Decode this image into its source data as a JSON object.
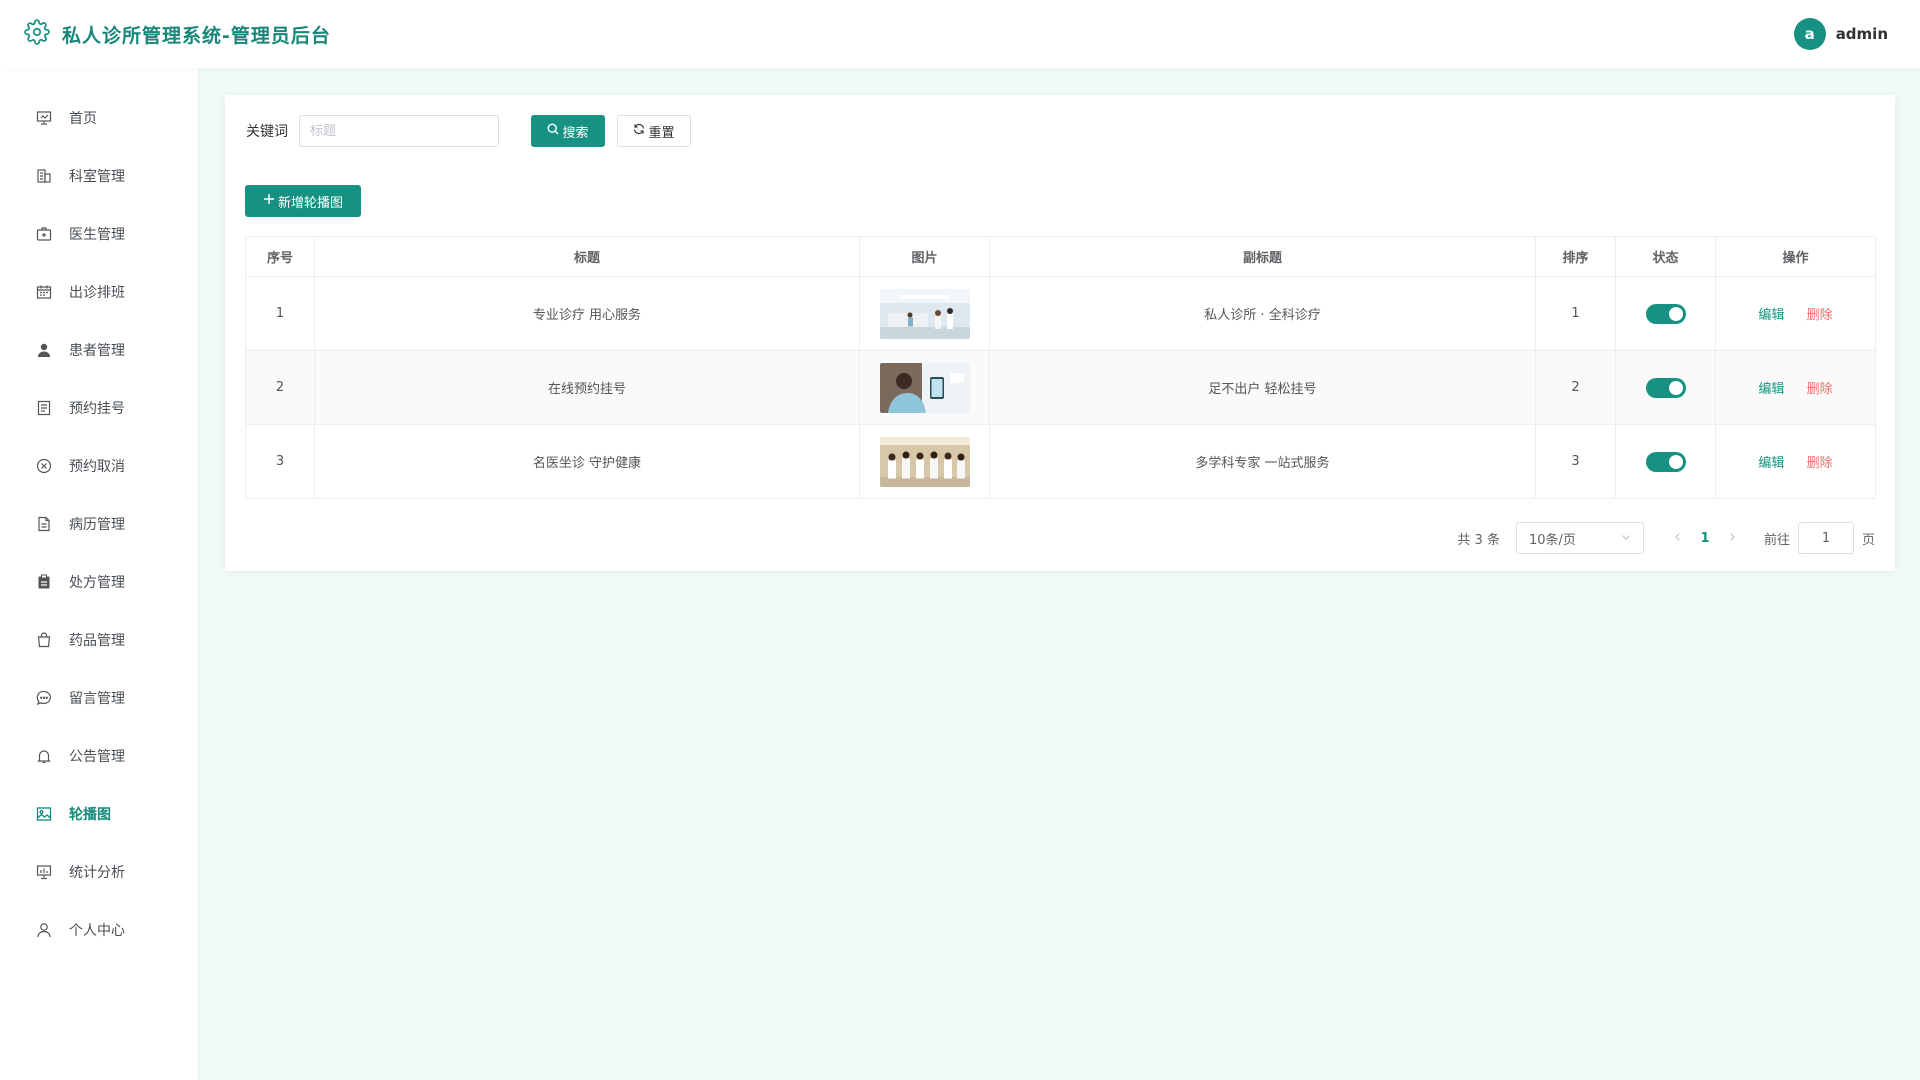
{
  "header": {
    "title": "私人诊所管理系统-管理员后台",
    "logo_icon": "gear-icon",
    "avatar_letter": "a",
    "username": "admin"
  },
  "sidebar": {
    "items": [
      {
        "label": "首页",
        "icon": "presentation-icon"
      },
      {
        "label": "科室管理",
        "icon": "building-icon"
      },
      {
        "label": "医生管理",
        "icon": "medical-kit-icon"
      },
      {
        "label": "出诊排班",
        "icon": "calendar-icon"
      },
      {
        "label": "患者管理",
        "icon": "user-filled-icon"
      },
      {
        "label": "预约挂号",
        "icon": "document-icon"
      },
      {
        "label": "预约取消",
        "icon": "circle-close-icon"
      },
      {
        "label": "病历管理",
        "icon": "file-icon"
      },
      {
        "label": "处方管理",
        "icon": "clipboard-icon"
      },
      {
        "label": "药品管理",
        "icon": "shopping-bag-icon"
      },
      {
        "label": "留言管理",
        "icon": "chat-icon"
      },
      {
        "label": "公告管理",
        "icon": "bell-icon"
      },
      {
        "label": "轮播图",
        "icon": "picture-icon",
        "active": true
      },
      {
        "label": "统计分析",
        "icon": "data-board-icon"
      },
      {
        "label": "个人中心",
        "icon": "user-icon"
      }
    ]
  },
  "search": {
    "label": "关键词",
    "placeholder": "标题",
    "value": "",
    "search_button": "搜索",
    "reset_button": "重置"
  },
  "add_button": "新增轮播图",
  "table": {
    "columns": [
      "序号",
      "标题",
      "图片",
      "副标题",
      "排序",
      "状态",
      "操作"
    ],
    "rows": [
      {
        "index": "1",
        "title": "专业诊疗 用心服务",
        "image": "clinic-lobby",
        "subtitle": "私人诊所 · 全科诊疗",
        "sort": "1",
        "enabled": true
      },
      {
        "index": "2",
        "title": "在线预约挂号",
        "image": "online-booking",
        "subtitle": "足不出户 轻松挂号",
        "sort": "2",
        "enabled": true
      },
      {
        "index": "3",
        "title": "名医坐诊 守护健康",
        "image": "doctor-team",
        "subtitle": "多学科专家 一站式服务",
        "sort": "3",
        "enabled": true
      }
    ],
    "edit_label": "编辑",
    "delete_label": "删除"
  },
  "pagination": {
    "total": "共 3 条",
    "page_size": "10条/页",
    "current_page": "1",
    "jump_label": "前往",
    "jump_value": "1",
    "jump_suffix": "页"
  },
  "colors": {
    "primary": "#179282",
    "danger": "#f56c6c",
    "page_bg": "#effaf7"
  }
}
